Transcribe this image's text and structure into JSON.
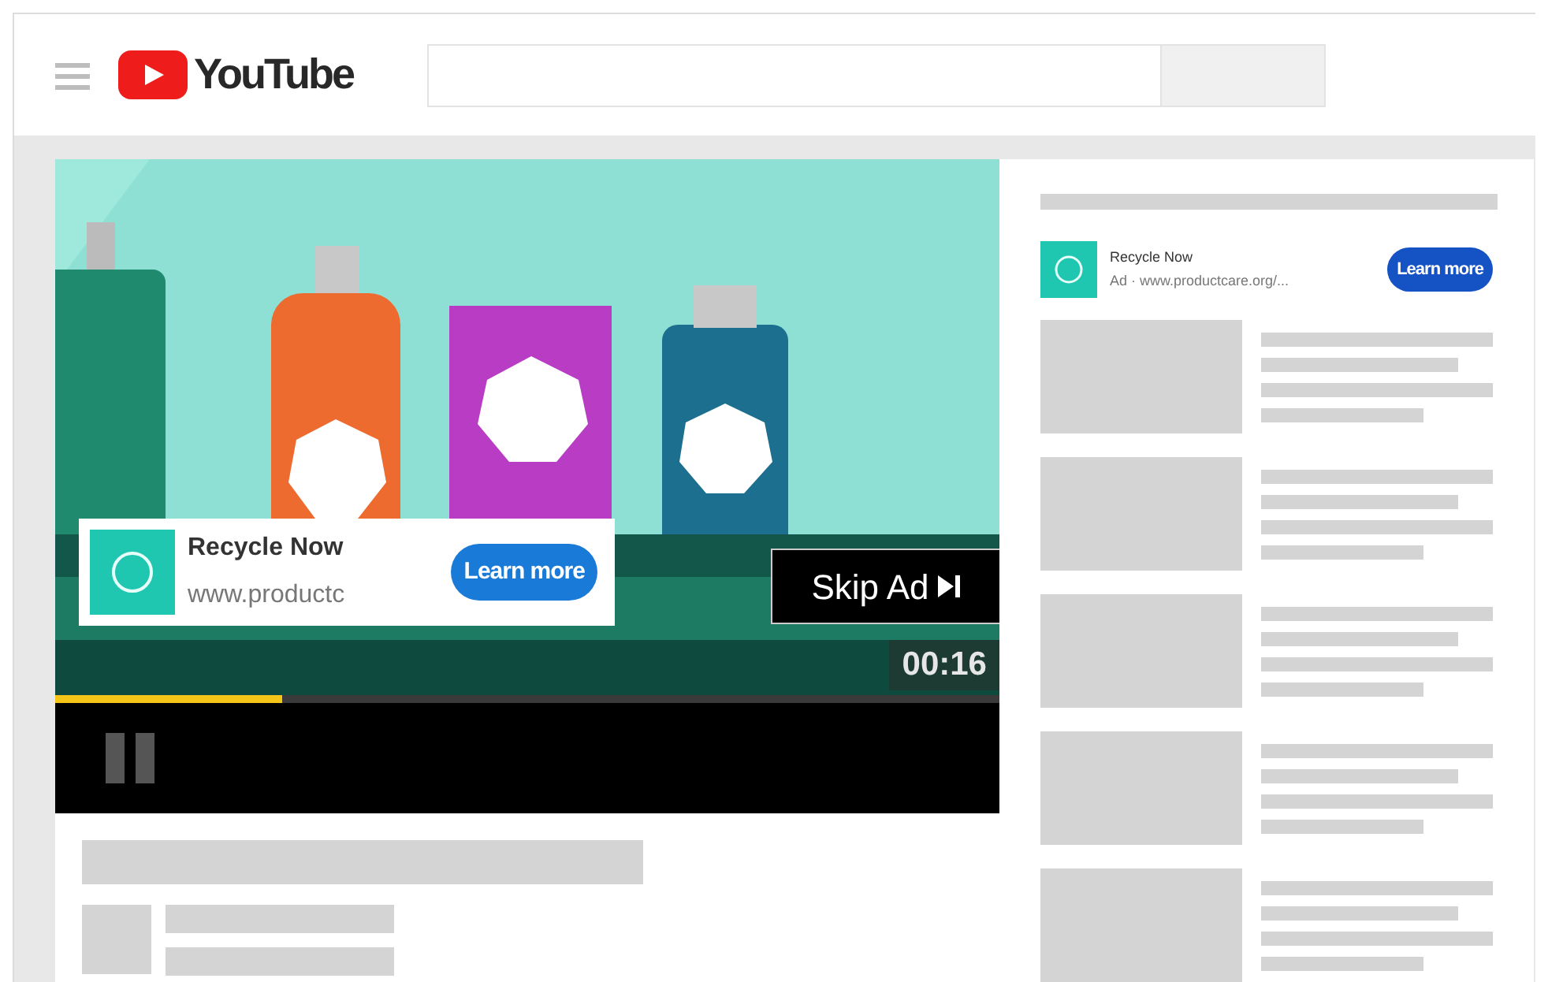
{
  "header": {
    "logo": "YouTube"
  },
  "video_ad": {
    "advertiser": "Recycle Now",
    "url": "www.productc",
    "cta": "Learn more",
    "skip": "Skip Ad",
    "time_left": "00:16",
    "progress": {
      "level": 0.24
    }
  },
  "sidebar_ad": {
    "advertiser": "Recycle Now",
    "url": "Ad · www.productcare.org/...",
    "cta": "Learn more"
  }
}
